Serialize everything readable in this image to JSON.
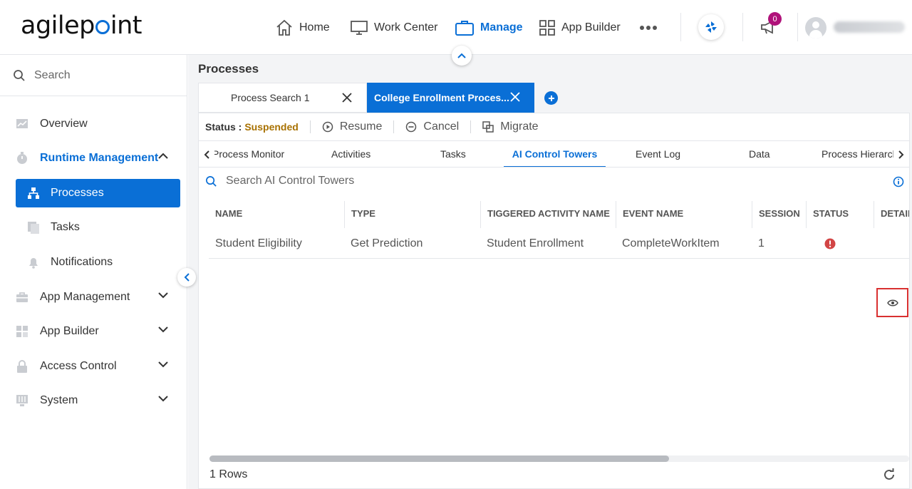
{
  "brand": {
    "logo_before": "agilep",
    "logo_after": "int"
  },
  "topnav": [
    {
      "label": "Home",
      "icon": "home-icon"
    },
    {
      "label": "Work Center",
      "icon": "monitor-icon"
    },
    {
      "label": "Manage",
      "icon": "briefcase-icon",
      "active": true
    },
    {
      "label": "App Builder",
      "icon": "grid-icon"
    }
  ],
  "notifications_count": "0",
  "sidebar": {
    "search_placeholder": "Search",
    "items": [
      {
        "label": "Overview",
        "icon": "chart-icon"
      },
      {
        "label": "Runtime Management",
        "icon": "stopwatch-icon",
        "expanded": true
      },
      {
        "label": "Processes",
        "icon": "hierarchy-icon",
        "selected": true
      },
      {
        "label": "Tasks",
        "icon": "tasks-icon"
      },
      {
        "label": "Notifications",
        "icon": "bell-icon"
      },
      {
        "label": "App Management",
        "icon": "toolbox-icon"
      },
      {
        "label": "App Builder",
        "icon": "widgets-icon"
      },
      {
        "label": "Access Control",
        "icon": "lock-icon"
      },
      {
        "label": "System",
        "icon": "sliders-icon"
      }
    ]
  },
  "main": {
    "title": "Processes",
    "tabs": [
      {
        "label": "Process Search 1"
      },
      {
        "label": "College Enrollment Proces..."
      }
    ],
    "toolbar": {
      "status_label": "Status :",
      "status_value": "Suspended",
      "resume": "Resume",
      "cancel": "Cancel",
      "migrate": "Migrate"
    },
    "subtabs": [
      "Process Monitor",
      "Activities",
      "Tasks",
      "AI Control Towers",
      "Event Log",
      "Data",
      "Process Hierarchy"
    ],
    "search_placeholder": "Search AI Control Towers",
    "grid": {
      "columns": [
        "NAME",
        "TYPE",
        "TIGGERED ACTIVITY NAME",
        "EVENT NAME",
        "SESSION",
        "STATUS",
        "DETAILS"
      ],
      "rows": [
        {
          "name": "Student Eligibility",
          "type": "Get Prediction",
          "activity": "Student Enrollment",
          "event": "CompleteWorkItem",
          "session": "1",
          "status": "error"
        }
      ]
    },
    "footer": {
      "rows_text": "1 Rows"
    }
  },
  "colors": {
    "accent": "#0a6fd6",
    "status_suspended": "#a87100",
    "error": "#d24545"
  }
}
